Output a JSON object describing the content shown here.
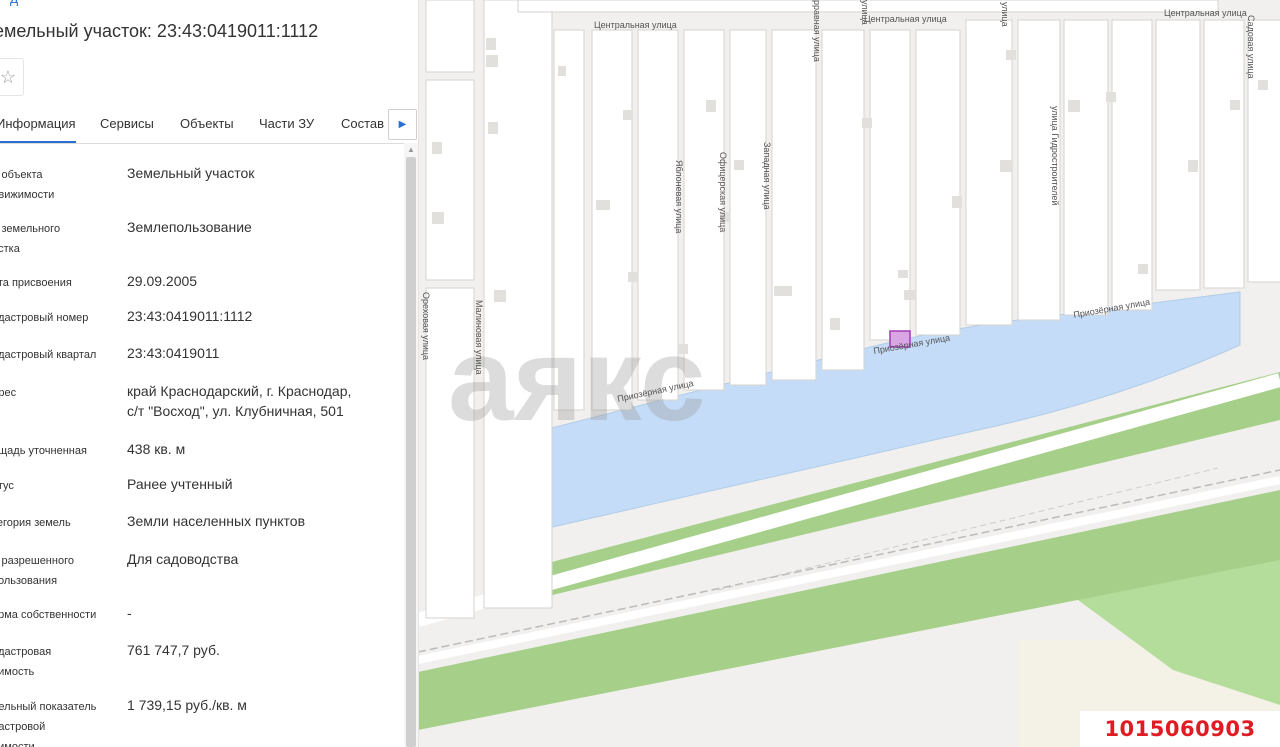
{
  "app": {
    "title": "емельный участок: 23:43:0419011:1112",
    "top_link": "д"
  },
  "favorite_icon": "star-outline-icon",
  "tabs": [
    {
      "label": "Информация",
      "active": true
    },
    {
      "label": "Сервисы",
      "active": false
    },
    {
      "label": "Объекты",
      "active": false
    },
    {
      "label": "Части ЗУ",
      "active": false
    },
    {
      "label": "Состав",
      "active": false
    }
  ],
  "tabs_next_icon": "chevron-right-icon",
  "info": [
    {
      "label": "д объекта\nдвижимости",
      "value": "Земельный участок"
    },
    {
      "label": "д земельного\nастка",
      "value": "Землепользование"
    },
    {
      "label": "ата присвоения",
      "value": "29.09.2005"
    },
    {
      "label": "адастровый номер",
      "value": "23:43:0419011:1112"
    },
    {
      "label": "адастровый квартал",
      "value": "23:43:0419011"
    },
    {
      "label": "дрес",
      "value": "край Краснодарский, г. Краснодар,\nс/т \"Восход\", ул. Клубничная, 501"
    },
    {
      "label": "ощадь уточненная",
      "value": "438 кв. м"
    },
    {
      "label": "атус",
      "value": "Ранее учтенный"
    },
    {
      "label": "тегория земель",
      "value": "Земли населенных пунктов"
    },
    {
      "label": "д разрешенного\nпользования",
      "value": "Для садоводства"
    },
    {
      "label": "орма собственности",
      "value": "-"
    },
    {
      "label": "адастровая\nоимость",
      "value": "761 747,7 руб."
    },
    {
      "label": "дельный показатель\nдастровой\nоимости",
      "value": "1 739,15 руб./кв. м"
    }
  ],
  "map": {
    "streets": {
      "central_1": "Центральная улица",
      "central_2": "Центральная улица",
      "central_3": "Центральная улица",
      "sadovaya": "Садовая улица",
      "ulica_top1": "улица",
      "ulica_top2": "улица",
      "yablonevaya": "Яблоневая улица",
      "oficerskaya": "Офицерская улица",
      "zapadnaya": "Западная улица",
      "gidrostroiteley": "улица Гидростроителей",
      "prioz_1": "Приозёрная улица",
      "prioz_2": "Приозёрная улица",
      "prioz_3": "Приозёрная улица",
      "orehovaya": "Ореховая улица",
      "malinovaya": "Малиновая улица",
      "top_partial": "рравная улица"
    },
    "watermark": "аякс",
    "colors": {
      "water": "#c4dcf7",
      "green": "#a6cf8a",
      "road": "#ffffff",
      "ground": "#f2f0ee",
      "parcel": "#b64fc8"
    }
  },
  "badge": "1015060903"
}
